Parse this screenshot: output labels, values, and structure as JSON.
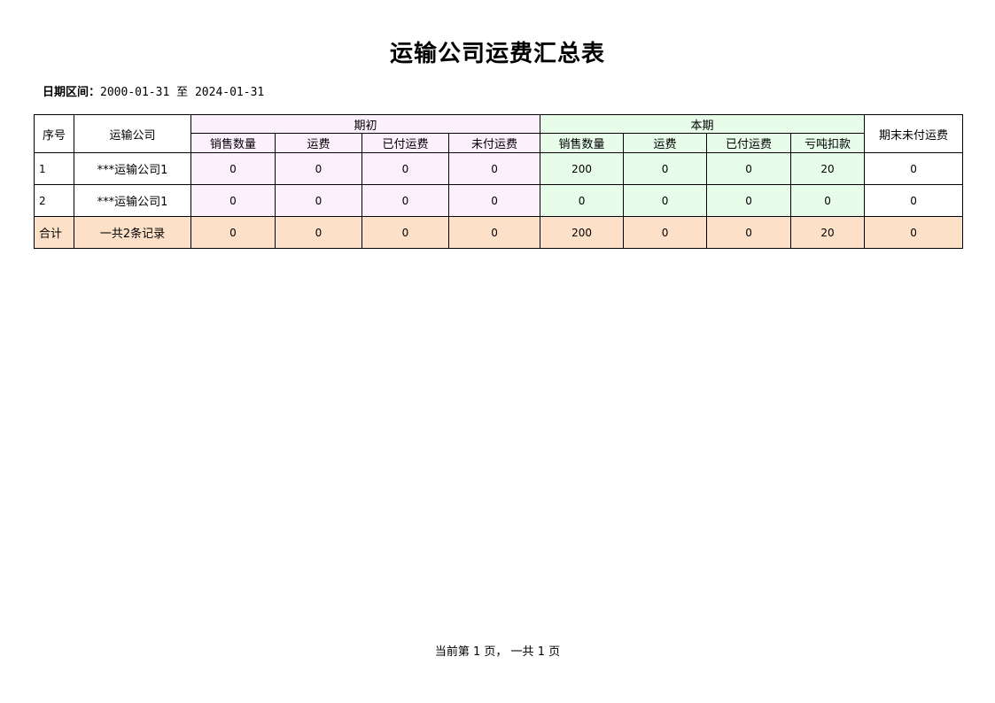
{
  "title": "运输公司运费汇总表",
  "date_range": {
    "label": "日期区间：",
    "start": "2000-01-31",
    "sep": "至",
    "end": "2024-01-31"
  },
  "header": {
    "seq": "序号",
    "company": "运输公司",
    "group_opening": "期初",
    "group_current": "本期",
    "ending_unpaid": "期末未付运费",
    "opening_cols": [
      "销售数量",
      "运费",
      "已付运费",
      "未付运费"
    ],
    "current_cols": [
      "销售数量",
      "运费",
      "已付运费",
      "亏吨扣款"
    ]
  },
  "rows": [
    {
      "seq": "1",
      "company": "***运输公司1",
      "opening": [
        "0",
        "0",
        "0",
        "0"
      ],
      "current": [
        "200",
        "0",
        "0",
        "20"
      ],
      "ending": "0"
    },
    {
      "seq": "2",
      "company": "***运输公司1",
      "opening": [
        "0",
        "0",
        "0",
        "0"
      ],
      "current": [
        "0",
        "0",
        "0",
        "0"
      ],
      "ending": "0"
    }
  ],
  "total": {
    "label": "合计",
    "count_text": "一共2条记录",
    "opening": [
      "0",
      "0",
      "0",
      "0"
    ],
    "current": [
      "200",
      "0",
      "0",
      "20"
    ],
    "ending": "0"
  },
  "footer": "当前第 1 页， 一共 1 页",
  "colors": {
    "opening_bg": "#fdf0fd",
    "current_bg": "#e7fde9",
    "total_bg": "#fde0c8"
  }
}
